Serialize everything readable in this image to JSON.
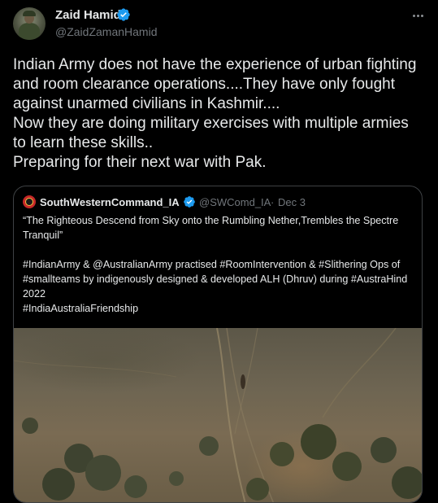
{
  "author": {
    "display_name": "Zaid Hamid",
    "handle": "@ZaidZamanHamid"
  },
  "tweet": {
    "text": "Indian Army does not have the experience of urban fighting and room clearance operations....They have only fought against unarmed civilians in Kashmir....\nNow they are doing military exercises with multiple armies to learn these skills..\nPreparing for their next war with Pak."
  },
  "quoted_tweet": {
    "display_name": "SouthWesternCommand_IA",
    "handle": "@SWComd_IA",
    "separator": "·",
    "date": "Dec 3",
    "text": "“The Righteous Descend from Sky onto the Rumbling Nether,Trembles the Spectre Tranquil”\n\n#IndianArmy & @AustralianArmy practised  #RoomIntervention & #Slithering Ops of #smallteams by indigenously designed & developed ALH (Dhruv) during #AustraHind 2022\n#IndiaAustraliaFriendship"
  },
  "colors": {
    "background": "#000000",
    "text_primary": "#e7e9ea",
    "text_secondary": "#71767b",
    "verified_badge": "#1d9bf0",
    "border": "#3e4144"
  },
  "icons": {
    "verified": "verified-badge-icon",
    "more": "more-options-icon"
  }
}
